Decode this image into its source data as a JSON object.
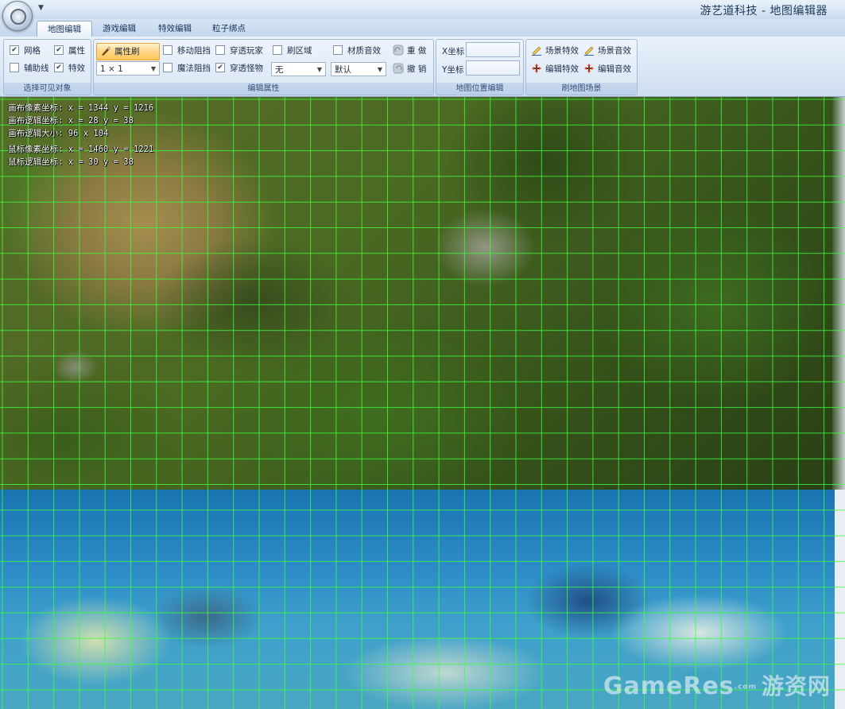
{
  "window": {
    "title": "游艺道科技 - 地图编辑器"
  },
  "tabs": [
    {
      "label": "地图编辑",
      "active": true
    },
    {
      "label": "游戏编辑",
      "active": false
    },
    {
      "label": "特效编辑",
      "active": false
    },
    {
      "label": "粒子绑点",
      "active": false
    }
  ],
  "ribbon": {
    "visible_group": {
      "caption": "选择可见对象",
      "items": [
        {
          "label": "网格",
          "checked": true
        },
        {
          "label": "属性",
          "checked": true
        },
        {
          "label": "辅助线",
          "checked": false
        },
        {
          "label": "特效",
          "checked": true
        }
      ]
    },
    "edit_group": {
      "caption": "编辑属性",
      "brush_label": "属性刷",
      "brush_size": "1 × 1",
      "items": [
        {
          "label": "移动阻挡",
          "checked": false
        },
        {
          "label": "穿透玩家",
          "checked": false
        },
        {
          "label": "魔法阻挡",
          "checked": false
        },
        {
          "label": "穿透怪物",
          "checked": true
        },
        {
          "label": "刷区域",
          "checked": false
        },
        {
          "label": "材质音效",
          "checked": false
        }
      ],
      "region_value": "无",
      "sound_value": "默认",
      "redo_label": "重 做",
      "undo_label": "撤 销"
    },
    "position_group": {
      "caption": "地图位置编辑",
      "x_label": "X坐标",
      "y_label": "Y坐标",
      "x_value": "",
      "y_value": ""
    },
    "scene_group": {
      "caption": "刷地图场景",
      "items": [
        {
          "label": "场景特效",
          "icon": "pencil-icon"
        },
        {
          "label": "场景音效",
          "icon": "pencil-icon"
        },
        {
          "label": "编辑特效",
          "icon": "move-cross-icon"
        },
        {
          "label": "编辑音效",
          "icon": "move-cross-icon"
        }
      ]
    }
  },
  "canvas_info": {
    "canvas_pixel": "画布像素坐标: x = 1344 y = 1216",
    "canvas_logic": "画布逻辑坐标: x = 28 y = 38",
    "canvas_size": "画布逻辑大小: 96 x 104",
    "mouse_pixel": "鼠标像素坐标: x = 1460 y = 1221",
    "mouse_logic": "鼠标逻辑坐标: x = 30 y = 38"
  },
  "watermark": {
    "latin": "GameRes",
    "dotcom": ".com",
    "cn": "游资网"
  },
  "colors": {
    "grid_line": "#3cff3c",
    "ribbon_bg": "#dae6f4",
    "brush_button": "#ffd685"
  }
}
